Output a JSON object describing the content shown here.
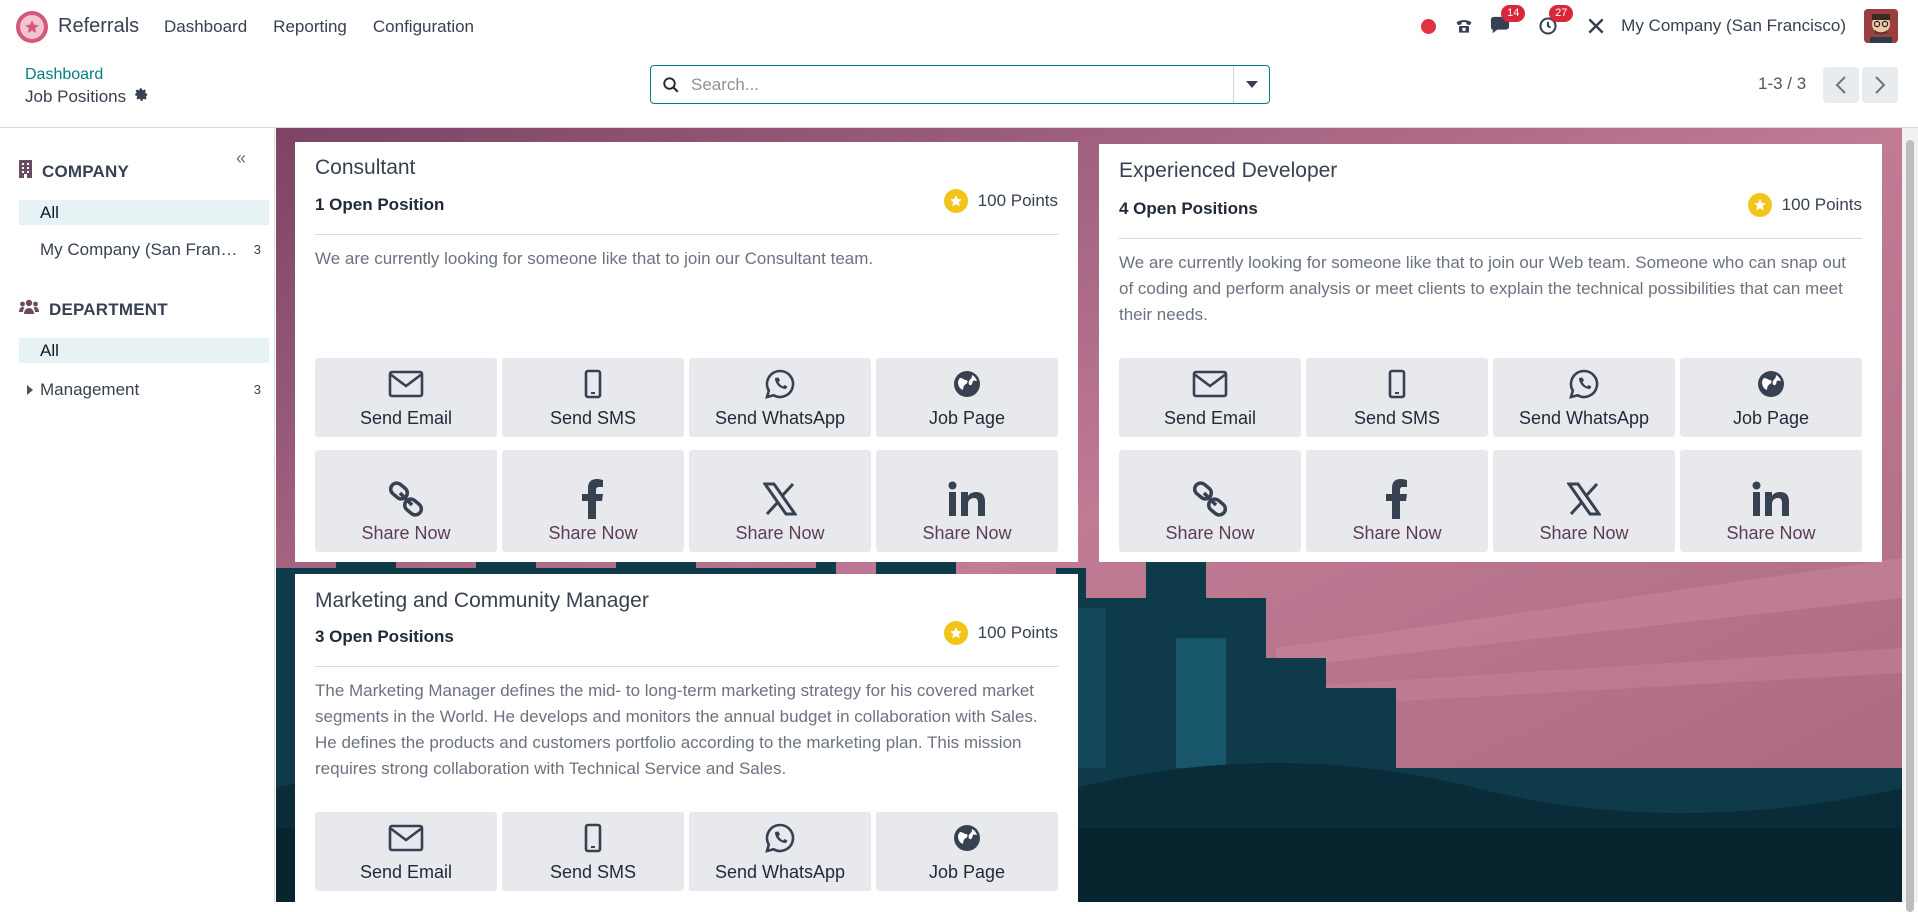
{
  "navbar": {
    "app_name": "Referrals",
    "menu": [
      "Dashboard",
      "Reporting",
      "Configuration"
    ],
    "messages_count": "14",
    "activities_count": "27",
    "company": "My Company (San Francisco)"
  },
  "control_panel": {
    "breadcrumb": "Dashboard",
    "title": "Job Positions",
    "search_placeholder": "Search...",
    "pager": "1-3 / 3"
  },
  "sidebar": {
    "company_heading": "COMPANY",
    "company_all": "All",
    "company_items": [
      {
        "label": "My Company (San Francisco)",
        "count": "3"
      }
    ],
    "department_heading": "DEPARTMENT",
    "department_all": "All",
    "department_items": [
      {
        "label": "Management",
        "count": "3"
      }
    ]
  },
  "cards": [
    {
      "title": "Consultant",
      "open_positions": "1 Open Position",
      "points": "100 Points",
      "description": "We are currently looking for someone like that to join our Consultant team."
    },
    {
      "title": "Experienced Developer",
      "open_positions": "4 Open Positions",
      "points": "100 Points",
      "description": "We are currently looking for someone like that to join our Web team. Someone who can snap out of coding and perform analysis or meet clients to explain the technical possibilities that can meet their needs."
    },
    {
      "title": "Marketing and Community Manager",
      "open_positions": "3 Open Positions",
      "points": "100 Points",
      "description": "The Marketing Manager defines the mid- to long-term marketing strategy for his covered market segments in the World. He develops and monitors the annual budget in collaboration with Sales. He defines the products and customers portfolio according to the marketing plan. This mission requires strong collaboration with Technical Service and Sales."
    }
  ],
  "actions": {
    "send_email": "Send Email",
    "send_sms": "Send SMS",
    "send_whatsapp": "Send WhatsApp",
    "job_page": "Job Page",
    "share_now": "Share Now"
  },
  "colors": {
    "accent": "#017e84",
    "badge": "#d9263a",
    "star": "#f5c41a",
    "background_sky": "#b67590",
    "background_city": "#0f3a4a"
  }
}
